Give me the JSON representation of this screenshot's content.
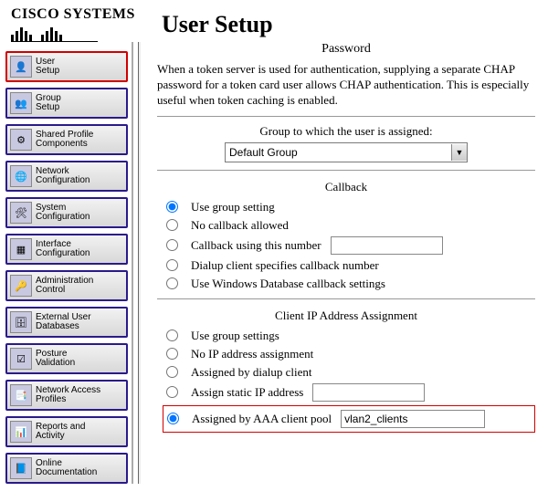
{
  "logo": {
    "brand": "CISCO SYSTEMS"
  },
  "page_title": "User Setup",
  "nav": {
    "items": [
      {
        "label": "User\nSetup",
        "glyph": "👤",
        "active": true
      },
      {
        "label": "Group\nSetup",
        "glyph": "👥"
      },
      {
        "label": "Shared Profile\nComponents",
        "glyph": "⚙"
      },
      {
        "label": "Network\nConfiguration",
        "glyph": "🌐"
      },
      {
        "label": "System\nConfiguration",
        "glyph": "🛠"
      },
      {
        "label": "Interface\nConfiguration",
        "glyph": "▦"
      },
      {
        "label": "Administration\nControl",
        "glyph": "🔑"
      },
      {
        "label": "External User\nDatabases",
        "glyph": "🗄"
      },
      {
        "label": "Posture\nValidation",
        "glyph": "☑"
      },
      {
        "label": "Network Access\nProfiles",
        "glyph": "📑"
      },
      {
        "label": "Reports and\nActivity",
        "glyph": "📊"
      },
      {
        "label": "Online\nDocumentation",
        "glyph": "📘"
      }
    ]
  },
  "password": {
    "title": "Password",
    "desc": "When a token server is used for authentication, supplying a separate CHAP password for a token card user allows CHAP authentication. This is especially useful when token caching is enabled."
  },
  "group": {
    "label": "Group to which the user is assigned:",
    "selected": "Default Group"
  },
  "callback": {
    "title": "Callback",
    "options": [
      "Use group setting",
      "No callback allowed",
      "Callback using this number",
      "Dialup client specifies callback number",
      "Use Windows Database callback settings"
    ],
    "number_value": ""
  },
  "ip": {
    "title": "Client IP Address Assignment",
    "options": [
      "Use group settings",
      "No IP address assignment",
      "Assigned by dialup client",
      "Assign static IP address",
      "Assigned by AAA client pool"
    ],
    "static_value": "",
    "pool_value": "vlan2_clients"
  }
}
